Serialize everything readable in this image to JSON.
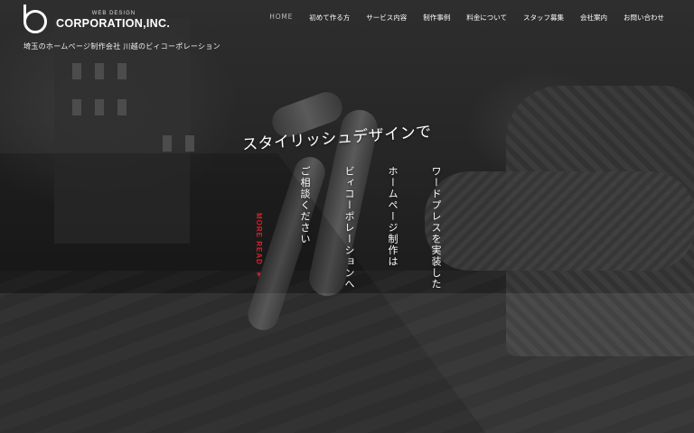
{
  "header": {
    "logo_sub": "WEB DESIGN",
    "logo_main": "CORPORATION,INC.",
    "tagline": "埼玉のホームページ制作会社 川越のビィコーポレーション"
  },
  "nav": {
    "items": [
      {
        "label": "HOME"
      },
      {
        "label": "初めて作る方"
      },
      {
        "label": "サービス内容"
      },
      {
        "label": "制作事例"
      },
      {
        "label": "料金について"
      },
      {
        "label": "スタッフ募集"
      },
      {
        "label": "会社案内"
      },
      {
        "label": "お問い合わせ"
      }
    ]
  },
  "hero": {
    "title": "スタイリッシュデザインで",
    "lines": [
      "ワードプレスを実装した",
      "ホームページ制作は",
      "ビィコーポレーションへ",
      "ご相談ください"
    ],
    "more_read": "MORE READ",
    "more_read_arrow": "▼"
  },
  "colors": {
    "accent": "#d2232a",
    "nav_active": "#bbbbbb"
  }
}
